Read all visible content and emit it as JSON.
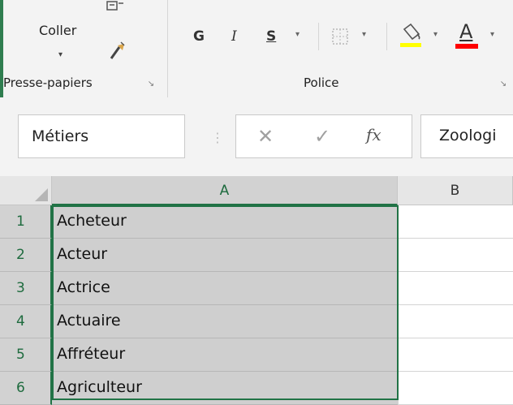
{
  "ribbon": {
    "clipboard": {
      "paste_label": "Coller",
      "group_label": "Presse-papiers"
    },
    "font": {
      "bold": "G",
      "italic": "I",
      "strike": "S",
      "font_color_letter": "A",
      "group_label": "Police",
      "fill_color": "#ffff00",
      "text_color": "#ff0000"
    }
  },
  "formula_bar": {
    "name_box": "Métiers",
    "content": "Zoologi"
  },
  "sheet": {
    "columns": [
      "A",
      "B"
    ],
    "rows": [
      {
        "num": "1",
        "a": "Acheteur"
      },
      {
        "num": "2",
        "a": "Acteur"
      },
      {
        "num": "3",
        "a": "Actrice"
      },
      {
        "num": "4",
        "a": "Actuaire"
      },
      {
        "num": "5",
        "a": "Affréteur"
      },
      {
        "num": "6",
        "a": "Agriculteur"
      }
    ]
  },
  "accent_color": "#217346"
}
